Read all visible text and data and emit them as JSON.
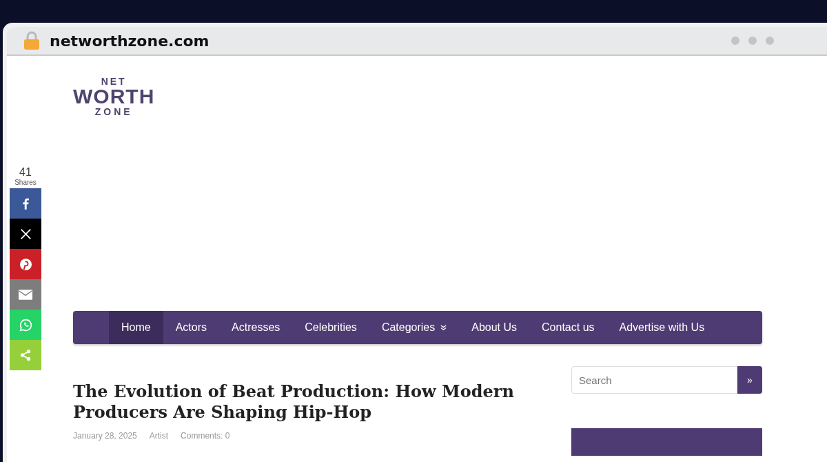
{
  "browser": {
    "url": "networthzone.com"
  },
  "logo": {
    "top": "NET",
    "middle": "WORTH",
    "bottom": "ZONE"
  },
  "share": {
    "count": "41",
    "label": "Shares",
    "buttons": [
      {
        "kind": "facebook",
        "color": "#3b5998"
      },
      {
        "kind": "x",
        "color": "#000000"
      },
      {
        "kind": "pinterest",
        "color": "#cb2027"
      },
      {
        "kind": "email",
        "color": "#7d7d7d"
      },
      {
        "kind": "whatsapp",
        "color": "#25d366"
      },
      {
        "kind": "share",
        "color": "#95d03a"
      }
    ]
  },
  "nav": [
    {
      "label": "Home",
      "selected": true,
      "dropdown": false
    },
    {
      "label": "Actors",
      "selected": false,
      "dropdown": false
    },
    {
      "label": "Actresses",
      "selected": false,
      "dropdown": false
    },
    {
      "label": "Celebrities",
      "selected": false,
      "dropdown": false
    },
    {
      "label": "Categories",
      "selected": false,
      "dropdown": true
    },
    {
      "label": "About Us",
      "selected": false,
      "dropdown": false
    },
    {
      "label": "Contact us",
      "selected": false,
      "dropdown": false
    },
    {
      "label": "Advertise with Us",
      "selected": false,
      "dropdown": false
    }
  ],
  "article": {
    "title": "The Evolution of Beat Production: How Modern Producers Are Shaping Hip-Hop",
    "date": "January 28, 2025",
    "category": "Artist",
    "comments": "Comments: 0"
  },
  "search": {
    "placeholder": "Search",
    "button": "»"
  }
}
